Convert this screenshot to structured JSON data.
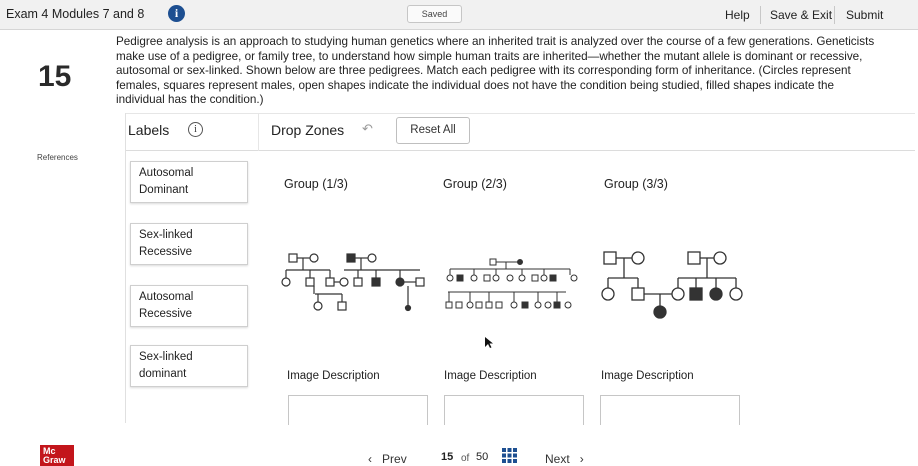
{
  "header": {
    "exam_title": "Exam 4 Modules 7 and 8",
    "info_glyph": "i",
    "saved": "Saved",
    "help": "Help",
    "save_exit": "Save & Exit",
    "submit": "Submit"
  },
  "question": {
    "number": "15",
    "text": "Pedigree analysis is an approach to studying human genetics where an inherited trait is analyzed over the course of a few generations. Geneticists make use of a pedigree, or family tree, to understand how simple human traits are inherited—whether the mutant allele is dominant or recessive, autosomal or sex-linked. Shown below are three pedigrees. Match each pedigree with its corresponding form of inheritance. (Circles represent females, squares represent males, open shapes indicate the individual does not have the condition being studied, filled shapes indicate the individual has the condition.)",
    "references": "References"
  },
  "dragdrop": {
    "labels_title": "Labels",
    "labels_info_glyph": "i",
    "drop_zones_title": "Drop Zones",
    "reset": "Reset All",
    "labels": [
      {
        "line1": "Autosomal",
        "line2": "Dominant"
      },
      {
        "line1": "Sex-linked",
        "line2": "Recessive"
      },
      {
        "line1": "Autosomal",
        "line2": "Recessive"
      },
      {
        "line1": "Sex-linked",
        "line2": "dominant"
      }
    ],
    "groups": [
      {
        "title": "Group (1/3)",
        "image_description": "Image Description"
      },
      {
        "title": "Group (2/3)",
        "image_description": "Image Description"
      },
      {
        "title": "Group (3/3)",
        "image_description": "Image Description"
      }
    ]
  },
  "footer": {
    "logo_line1": "Mc",
    "logo_line2": "Graw",
    "prev": "Prev",
    "page_current": "15",
    "page_of": "of",
    "page_total": "50",
    "next": "Next"
  },
  "colors": {
    "accent": "#1d4f91",
    "logo": "#c3151b",
    "affected": "#333333"
  },
  "icons": [
    "info-icon",
    "undo-icon",
    "grid-icon",
    "chevron-left-icon",
    "chevron-right-icon",
    "cursor-icon"
  ]
}
